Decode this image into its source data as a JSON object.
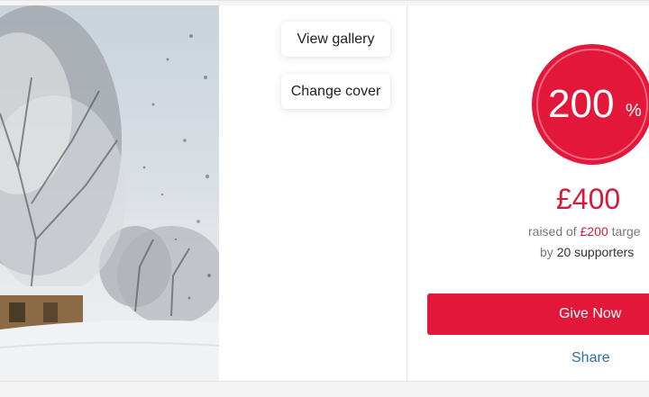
{
  "gallery": {
    "view_label": "View gallery",
    "change_cover_label": "Change cover"
  },
  "progress": {
    "percent_value": "200",
    "percent_sign": "%",
    "raised_amount": "£400",
    "target_prefix": "raised of ",
    "target_amount": "£200",
    "target_suffix": " targe",
    "supporters_prefix": "by ",
    "supporters_count": "20 supporters"
  },
  "actions": {
    "give_label": "Give Now",
    "share_label": "Share"
  },
  "colors": {
    "accent": "#e3173a",
    "link": "#2a6eb4"
  }
}
